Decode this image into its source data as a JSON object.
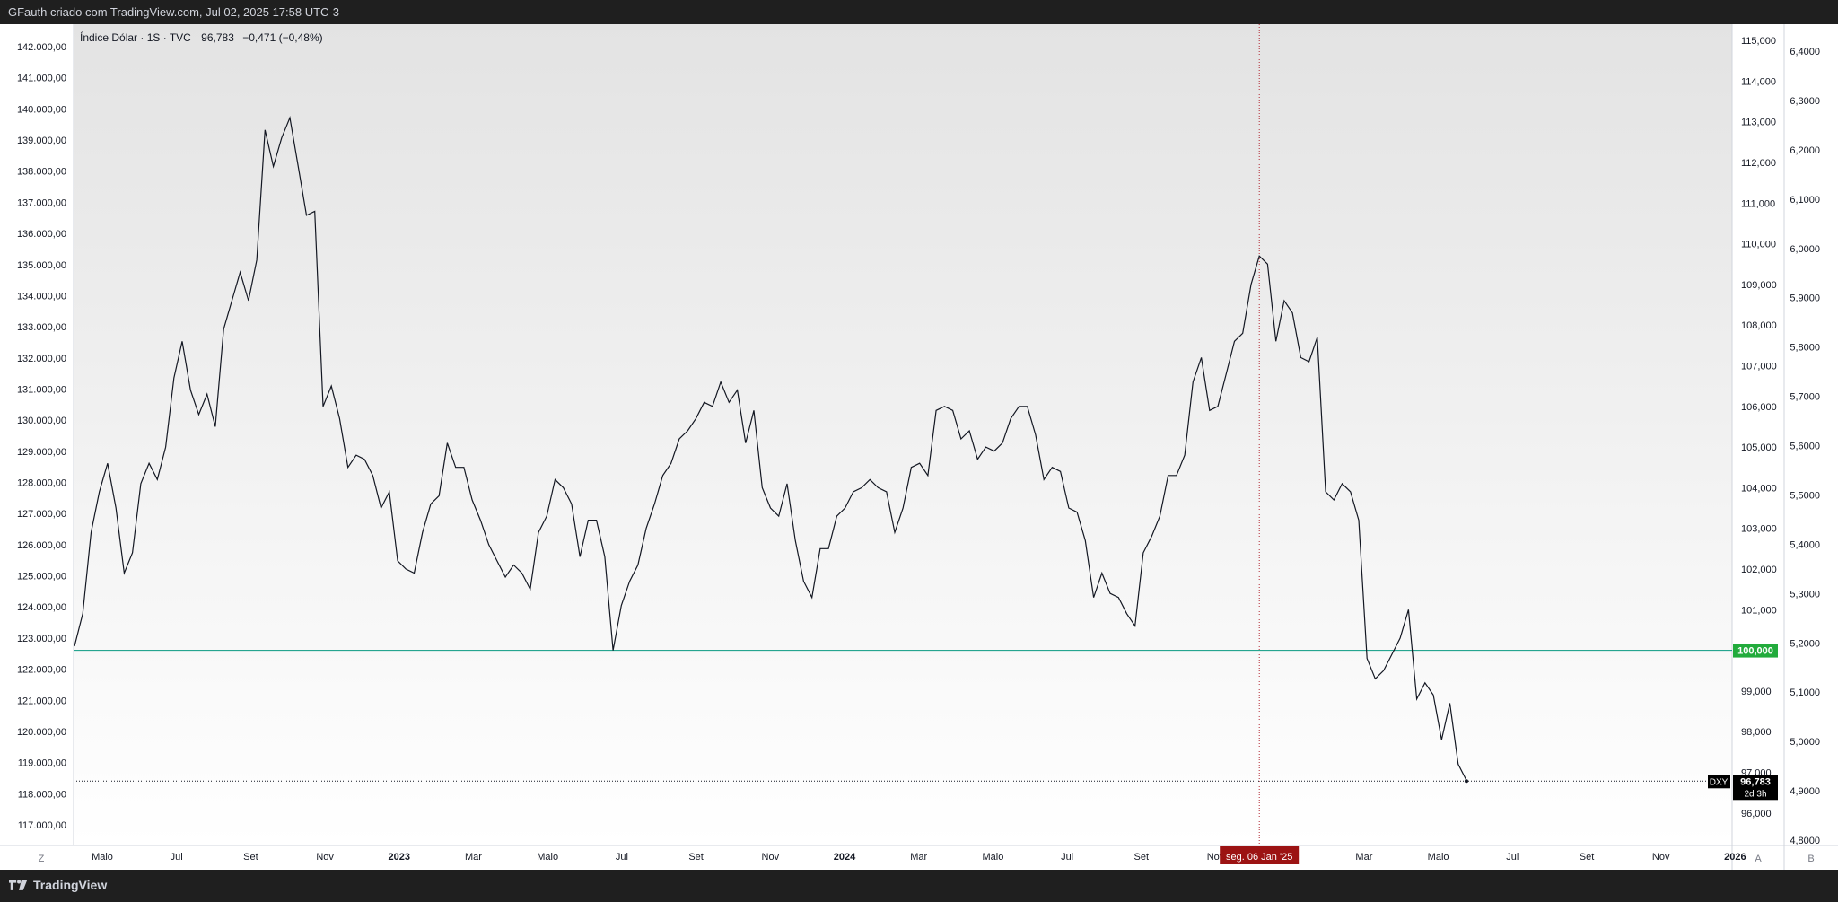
{
  "header": {
    "title": "GFauth criado com TradingView.com, Jul 02, 2025 17:58 UTC-3"
  },
  "footer": {
    "brand": "TradingView"
  },
  "legend": {
    "symbol": "Índice Dólar · 1S · TVC",
    "price": "96,783",
    "change": "−0,471 (−0,48%)"
  },
  "colors": {
    "line": "#131722",
    "level_line": "#089981",
    "level_label": "#22ab3c",
    "crosshair": "#b22833",
    "crosshair_label": "#9c1313",
    "price_label": "#000000"
  },
  "axis_buttons": {
    "left": "Z",
    "auto": "A",
    "log": "B"
  },
  "crosshair": {
    "label": "seg. 06 Jan '25"
  },
  "level": {
    "value": 100.0,
    "label": "100,000"
  },
  "last_price": {
    "ticker": "DXY",
    "value": 96.783,
    "label": "96,783",
    "countdown": "2d 3h"
  },
  "chart_data": {
    "type": "line",
    "title": "",
    "series": [
      {
        "values": [
          100.1,
          100.9,
          102.9,
          103.9,
          104.6,
          103.5,
          101.9,
          102.4,
          104.1,
          104.6,
          104.2,
          105.0,
          106.7,
          107.6,
          106.4,
          105.8,
          106.3,
          105.5,
          107.9,
          108.6,
          109.3,
          108.6,
          109.6,
          112.8,
          111.9,
          112.6,
          113.1,
          111.9,
          110.7,
          110.8,
          106.0,
          106.5,
          105.7,
          104.5,
          104.8,
          104.7,
          104.3,
          103.5,
          103.9,
          102.2,
          102.0,
          101.9,
          102.9,
          103.6,
          103.8,
          105.1,
          104.5,
          104.5,
          103.7,
          103.2,
          102.6,
          102.2,
          101.8,
          102.1,
          101.9,
          101.5,
          102.9,
          103.3,
          104.2,
          104.0,
          103.6,
          102.3,
          103.2,
          103.2,
          102.3,
          100.0,
          101.1,
          101.7,
          102.1,
          103.0,
          103.6,
          104.3,
          104.6,
          105.2,
          105.4,
          105.7,
          106.1,
          106.0,
          106.6,
          106.1,
          106.4,
          105.1,
          105.9,
          104.0,
          103.5,
          103.3,
          104.1,
          102.7,
          101.7,
          101.3,
          102.5,
          102.5,
          103.3,
          103.5,
          103.9,
          104.0,
          104.2,
          104.0,
          103.9,
          102.9,
          103.5,
          104.5,
          104.6,
          104.3,
          105.9,
          106.0,
          105.9,
          105.2,
          105.4,
          104.7,
          105.0,
          104.9,
          105.1,
          105.7,
          106.0,
          106.0,
          105.3,
          104.2,
          104.5,
          104.4,
          103.5,
          103.4,
          102.7,
          101.3,
          101.9,
          101.4,
          101.3,
          100.9,
          100.6,
          102.4,
          102.8,
          103.3,
          104.3,
          104.3,
          104.8,
          106.6,
          107.2,
          105.9,
          106.0,
          106.8,
          107.6,
          107.8,
          109.0,
          109.7,
          109.5,
          107.6,
          108.6,
          108.3,
          107.2,
          107.1,
          107.7,
          103.9,
          103.7,
          104.1,
          103.9,
          103.2,
          99.8,
          99.3,
          99.5,
          99.9,
          100.3,
          101.0,
          98.8,
          99.2,
          98.9,
          97.8,
          98.7,
          97.2,
          96.8
        ]
      }
    ],
    "x_labels": [
      "Maio",
      "Jul",
      "Set",
      "Nov",
      "2023",
      "Mar",
      "Maio",
      "Jul",
      "Set",
      "Nov",
      "2024",
      "Mar",
      "Maio",
      "Jul",
      "Set",
      "Nov",
      "Jan",
      "Mar",
      "Maio",
      "Jul",
      "Set",
      "Nov",
      "2026"
    ],
    "right_axis": {
      "ylim": [
        95.2,
        115.4
      ],
      "ticks": [
        96,
        97,
        98,
        99,
        100,
        101,
        102,
        103,
        104,
        105,
        106,
        107,
        108,
        109,
        110,
        111,
        112,
        113,
        114,
        115
      ],
      "tick_labels": [
        "96,000",
        "97,000",
        "98,000",
        "99,000",
        "100,000",
        "101,000",
        "102,000",
        "103,000",
        "104,000",
        "105,000",
        "106,000",
        "107,000",
        "108,000",
        "109,000",
        "110,000",
        "111,000",
        "112,000",
        "113,000",
        "114,000",
        "115,000"
      ]
    },
    "left_axis": {
      "ticks": [
        117000,
        118000,
        119000,
        120000,
        121000,
        122000,
        123000,
        124000,
        125000,
        126000,
        127000,
        128000,
        129000,
        130000,
        131000,
        132000,
        133000,
        134000,
        135000,
        136000,
        137000,
        138000,
        139000,
        140000,
        141000,
        142000
      ],
      "tick_labels": [
        "117.000,00",
        "118.000,00",
        "119.000,00",
        "120.000,00",
        "121.000,00",
        "122.000,00",
        "123.000,00",
        "124.000,00",
        "125.000,00",
        "126.000,00",
        "127.000,00",
        "128.000,00",
        "129.000,00",
        "130.000,00",
        "131.000,00",
        "132.000,00",
        "133.000,00",
        "134.000,00",
        "135.000,00",
        "136.000,00",
        "137.000,00",
        "138.000,00",
        "139.000,00",
        "140.000,00",
        "141.000,00",
        "142.000,00"
      ]
    },
    "far_right_axis": {
      "ticks": [
        4.8,
        4.9,
        5.0,
        5.1,
        5.2,
        5.3,
        5.4,
        5.5,
        5.6,
        5.7,
        5.8,
        5.9,
        6.0,
        6.1,
        6.2,
        6.3,
        6.4
      ],
      "tick_labels": [
        "4,8000",
        "4,9000",
        "5,0000",
        "5,1000",
        "5,2000",
        "5,3000",
        "5,4000",
        "5,5000",
        "5,6000",
        "5,7000",
        "5,8000",
        "5,9000",
        "6,0000",
        "6,1000",
        "6,2000",
        "6,3000",
        "6,4000"
      ]
    },
    "grid": false,
    "legend": "top-left"
  }
}
